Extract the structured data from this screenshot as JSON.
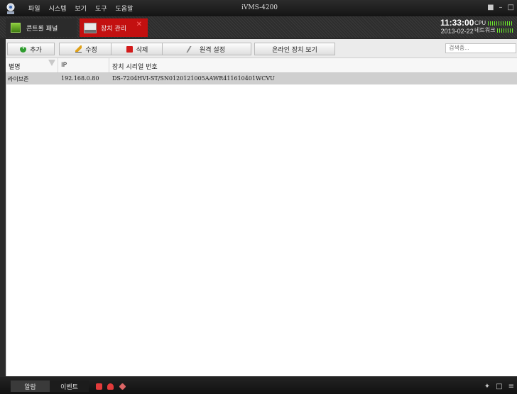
{
  "titlebar": {
    "menu": [
      "파일",
      "시스템",
      "보기",
      "도구",
      "도움말"
    ],
    "title": "iVMS-4200"
  },
  "tabs": [
    {
      "label": "콘트롤 패널"
    },
    {
      "label": "장치 관리"
    }
  ],
  "status": {
    "time": "11:33:00",
    "date": "2013-02-22",
    "cpu_label": "CPU",
    "network_label": "네트워크"
  },
  "toolbar": {
    "add": "추가",
    "edit": "수정",
    "delete": "삭제",
    "remote": "원격 설정",
    "online": "온라인 장치 보기",
    "search_placeholder": "검색중..."
  },
  "table": {
    "headers": {
      "alias": "별명",
      "ip": "IP",
      "serial": "장치 시리얼 번호"
    },
    "rows": [
      {
        "alias": "라이브존",
        "ip": "192.168.0.80",
        "serial": "DS-7204HVI-ST/SN0120121005AAWR411610401WCVU"
      }
    ]
  },
  "statusbar": {
    "alarm": "알람",
    "event": "이벤트"
  }
}
